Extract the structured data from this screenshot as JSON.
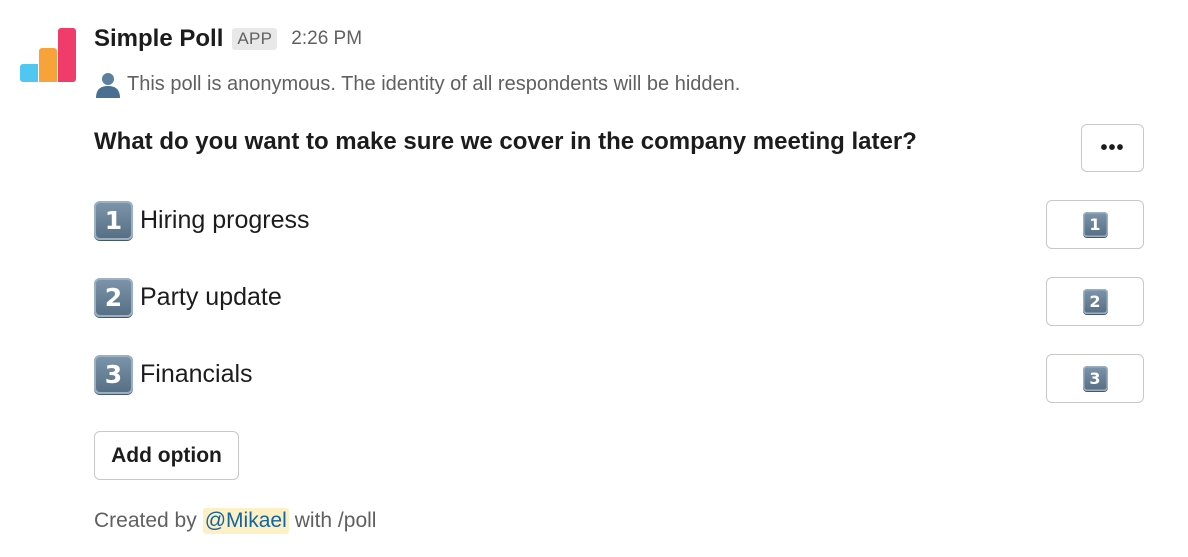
{
  "app": {
    "name": "Simple Poll",
    "badge": "APP",
    "timestamp": "2:26 PM",
    "logo_colors": [
      "#4fc7f0",
      "#f7a33a",
      "#f03c6a"
    ]
  },
  "notice": {
    "icon": "user-silhouette-icon",
    "text": "This poll is anonymous. The identity of all respondents will be hidden."
  },
  "poll": {
    "question": "What do you want to make sure we cover in the company meeting later?",
    "more_label": "•••",
    "options": [
      {
        "number": "1",
        "label": "Hiring progress"
      },
      {
        "number": "2",
        "label": "Party update"
      },
      {
        "number": "3",
        "label": "Financials"
      }
    ],
    "add_option_label": "Add option"
  },
  "footer": {
    "prefix": "Created by",
    "mention": "@Mikael",
    "suffix": "with /poll"
  }
}
